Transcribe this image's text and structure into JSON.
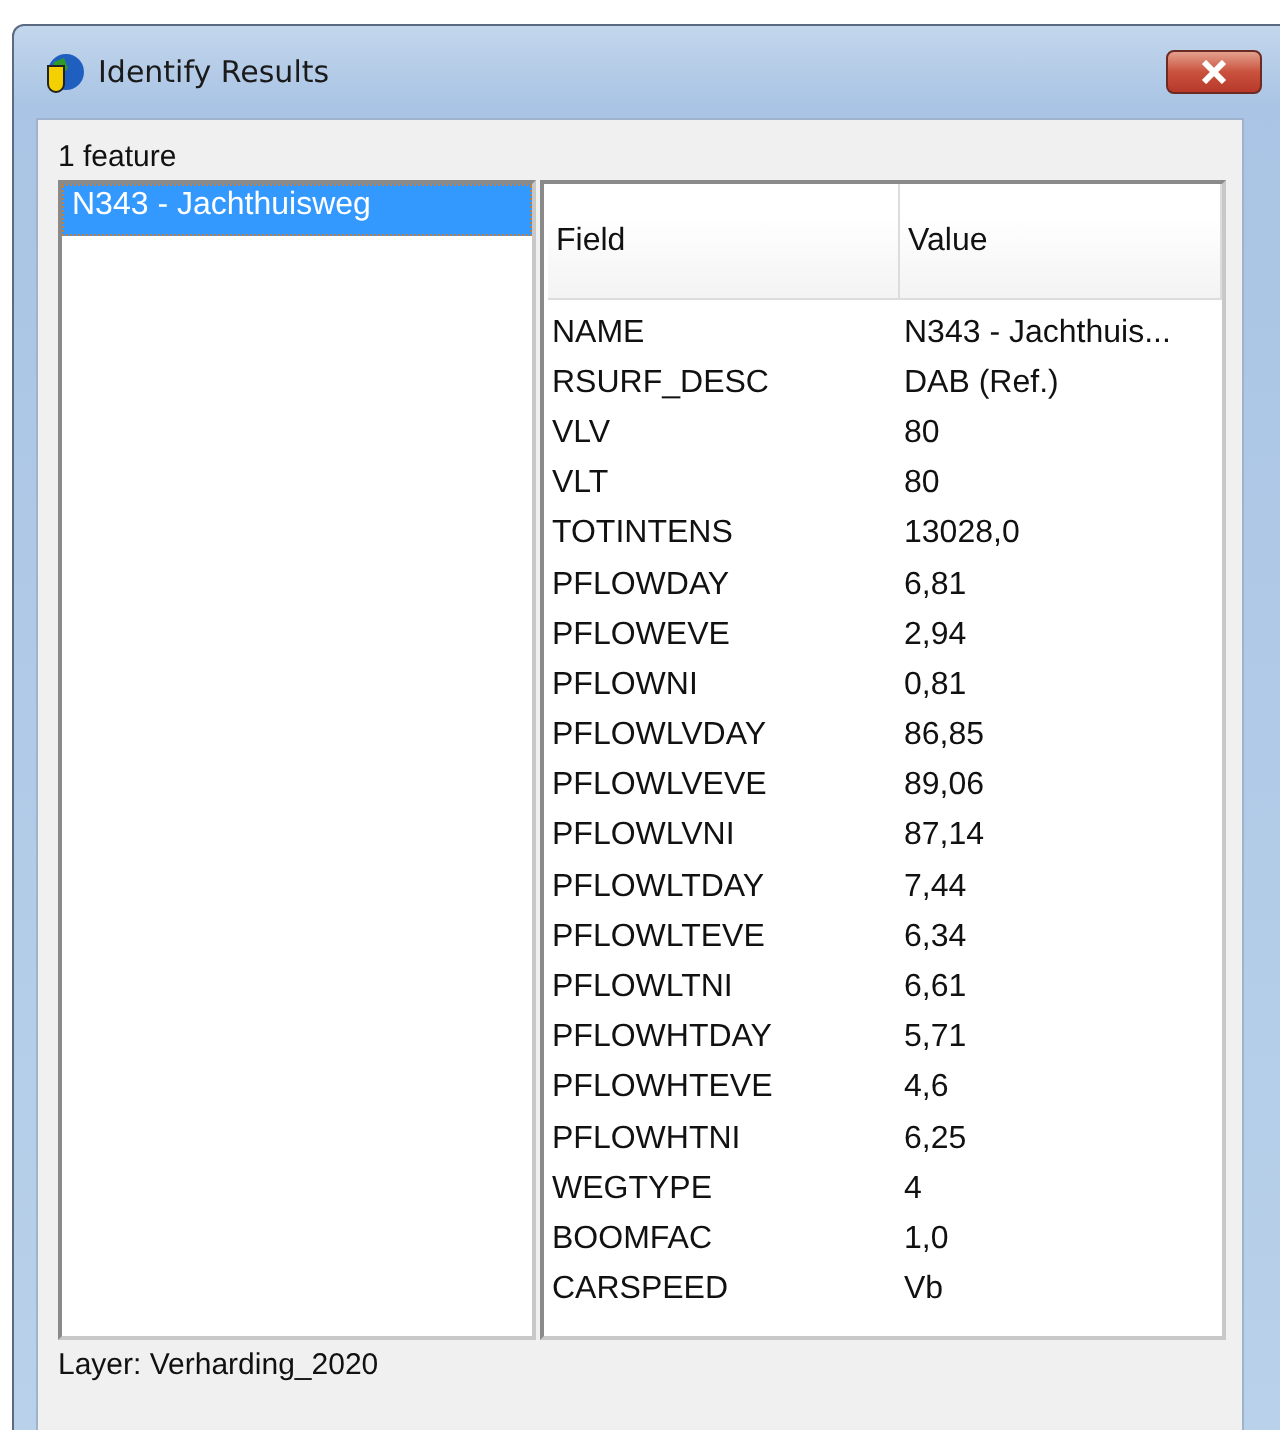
{
  "window": {
    "title": "Identify Results"
  },
  "feature_count": "1 feature",
  "features": [
    {
      "label": "N343 - Jachthuisweg",
      "selected": true
    }
  ],
  "table": {
    "columns": [
      "Field",
      "Value"
    ],
    "rows": [
      [
        "NAME",
        "N343 - Jachthuis..."
      ],
      [
        "RSURF_DESC",
        "DAB (Ref.)"
      ],
      [
        "VLV",
        "80"
      ],
      [
        "VLT",
        "80"
      ],
      [
        "TOTINTENS",
        "13028,0"
      ],
      [
        "PFLOWDAY",
        "6,81"
      ],
      [
        "PFLOWEVE",
        "2,94"
      ],
      [
        "PFLOWNI",
        "0,81"
      ],
      [
        "PFLOWLVDAY",
        "86,85"
      ],
      [
        "PFLOWLVEVE",
        "89,06"
      ],
      [
        "PFLOWLVNI",
        "87,14"
      ],
      [
        "PFLOWLTDAY",
        "7,44"
      ],
      [
        "PFLOWLTEVE",
        "6,34"
      ],
      [
        "PFLOWLTNI",
        "6,61"
      ],
      [
        "PFLOWHTDAY",
        "5,71"
      ],
      [
        "PFLOWHTEVE",
        "4,6"
      ],
      [
        "PFLOWHTNI",
        "6,25"
      ],
      [
        "WEGTYPE",
        "4"
      ],
      [
        "BOOMFAC",
        "1,0"
      ],
      [
        "CARSPEED",
        "Vb"
      ]
    ]
  },
  "status": "Layer: Verharding_2020"
}
